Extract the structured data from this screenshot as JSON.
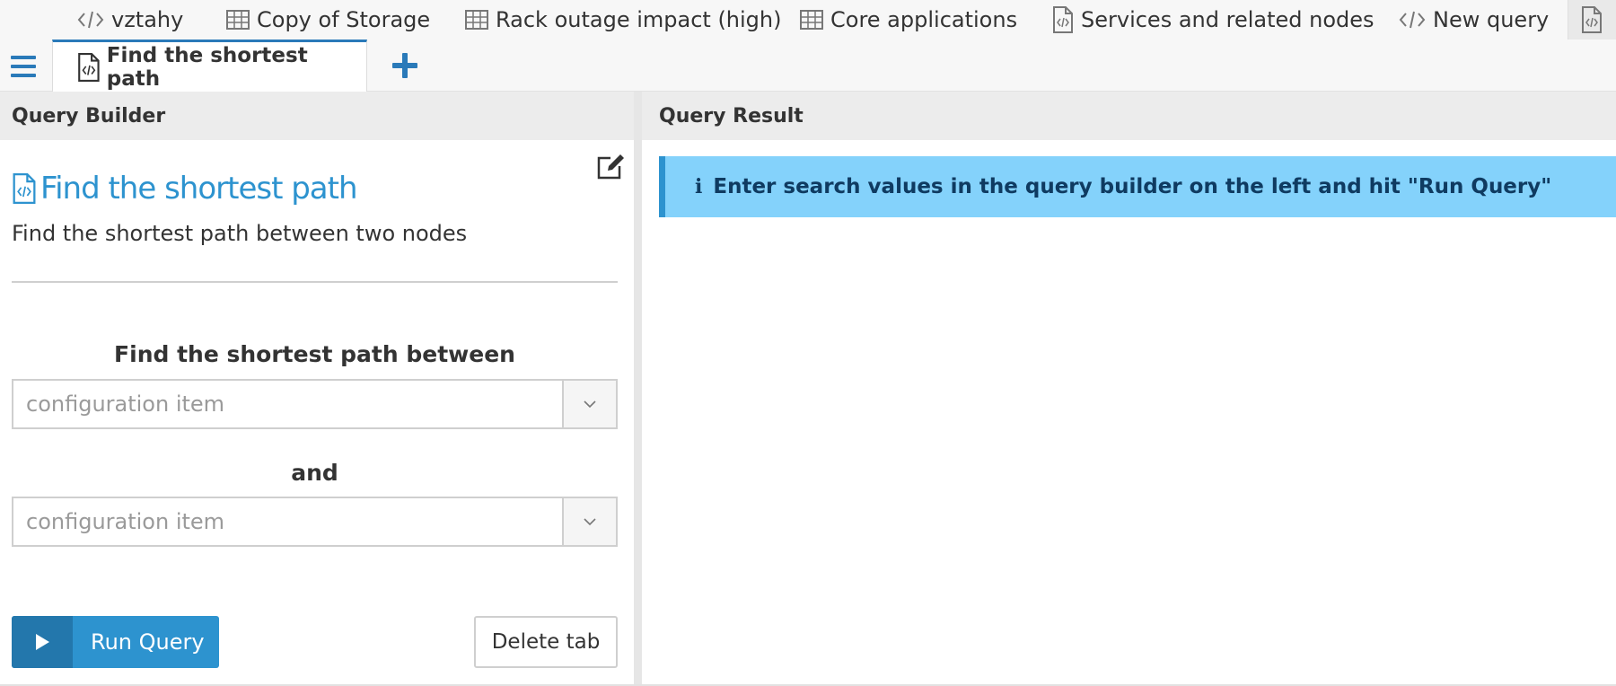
{
  "saved_queries": [
    {
      "label": "vztahy",
      "icon": "code-icon"
    },
    {
      "label": "Copy of Storage",
      "icon": "table-icon"
    },
    {
      "label": "Rack outage impact (high)",
      "icon": "table-icon"
    },
    {
      "label": "Core applications",
      "icon": "table-icon"
    },
    {
      "label": "Services and related nodes",
      "icon": "code-file-icon"
    },
    {
      "label": "New query",
      "icon": "code-icon"
    }
  ],
  "tabs": {
    "active_label": "Find the shortest path",
    "add_icon": "plus-icon",
    "menu_icon": "hamburger-menu-icon"
  },
  "builder": {
    "header": "Query Builder",
    "title": "Find the shortest path",
    "description": "Find the shortest path between two nodes",
    "label_between": "Find the shortest path between",
    "field1_placeholder": "configuration item",
    "label_and": "and",
    "field2_placeholder": "configuration item",
    "run_label": "Run Query",
    "delete_label": "Delete tab"
  },
  "result": {
    "header": "Query Result",
    "info_icon": "i",
    "info_text": "Enter search values in the query builder on the left and hit \"Run Query\""
  },
  "colors": {
    "accent": "#2d93cf",
    "accent_dark": "#2377ac",
    "info_bg": "#84d2fb",
    "info_text": "#0f3b61"
  }
}
